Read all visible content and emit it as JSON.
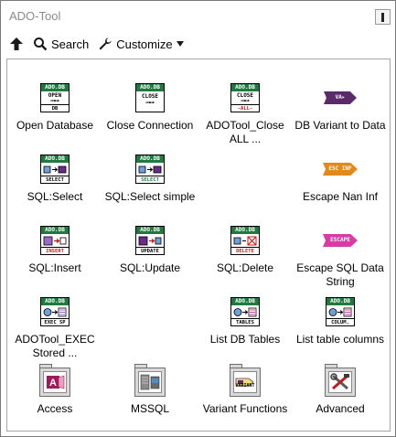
{
  "window": {
    "title": "ADO-Tool"
  },
  "toolbar": {
    "search_label": "Search",
    "customize_label": "Customize"
  },
  "items": [
    {
      "label": "Open Database",
      "icon": "ado-open-database-icon",
      "header": "ADO.DB",
      "footer": "DB",
      "caption": "OPEN"
    },
    {
      "label": "Close Connection",
      "icon": "ado-close-connection-icon",
      "header": "ADO.DB",
      "footer": "",
      "caption": "CLOSE"
    },
    {
      "label": "ADOTool_Close ALL ...",
      "icon": "ado-close-all-icon",
      "header": "ADO.DB",
      "footer": "-ALL-",
      "caption": "CLOSE"
    },
    {
      "label": "DB Variant to Data",
      "icon": "variant-to-data-icon",
      "tag": "VA"
    },
    {
      "label": "SQL:Select",
      "icon": "sql-select-icon",
      "header": "ADO.DB",
      "footer": "SELECT"
    },
    {
      "label": "SQL:Select simple",
      "icon": "sql-select-simple-icon",
      "header": "ADO.DB",
      "footer": "SELECT"
    },
    {
      "label": "Escape Nan Inf",
      "icon": "escape-nan-inf-icon",
      "tag": "ESC INF"
    },
    {
      "label": "SQL:Insert",
      "icon": "sql-insert-icon",
      "header": "ADO.DB",
      "footer": "INSERT"
    },
    {
      "label": "SQL:Update",
      "icon": "sql-update-icon",
      "header": "ADO.DB",
      "footer": "UPDATE"
    },
    {
      "label": "SQL:Delete",
      "icon": "sql-delete-icon",
      "header": "ADO.DB",
      "footer": "DELETE"
    },
    {
      "label": "Escape SQL Data String",
      "icon": "escape-sql-string-icon",
      "tag": "ESCAPE"
    },
    {
      "label": "ADOTool_EXEC Stored ...",
      "icon": "exec-stored-icon",
      "header": "ADO.DB",
      "footer": "EXEC SP"
    },
    {
      "label": "List DB Tables",
      "icon": "list-tables-icon",
      "header": "ADO.DB",
      "footer": "TABLES"
    },
    {
      "label": "List table columns",
      "icon": "list-columns-icon",
      "header": "ADO.DB",
      "footer": "COLUM."
    },
    {
      "label": "Access",
      "icon": "access-folder-icon"
    },
    {
      "label": "MSSQL",
      "icon": "mssql-folder-icon"
    },
    {
      "label": "Variant Functions",
      "icon": "variant-folder-icon",
      "inner": "VARIANT"
    },
    {
      "label": "Advanced",
      "icon": "advanced-folder-icon"
    }
  ],
  "colors": {
    "ado_header": "#1f7a3d",
    "tag_variant": "#5a2a6a",
    "tag_escape_inf": "#e08a1a",
    "tag_escape_sql": "#d83aa8",
    "delete_red": "#c81818"
  }
}
